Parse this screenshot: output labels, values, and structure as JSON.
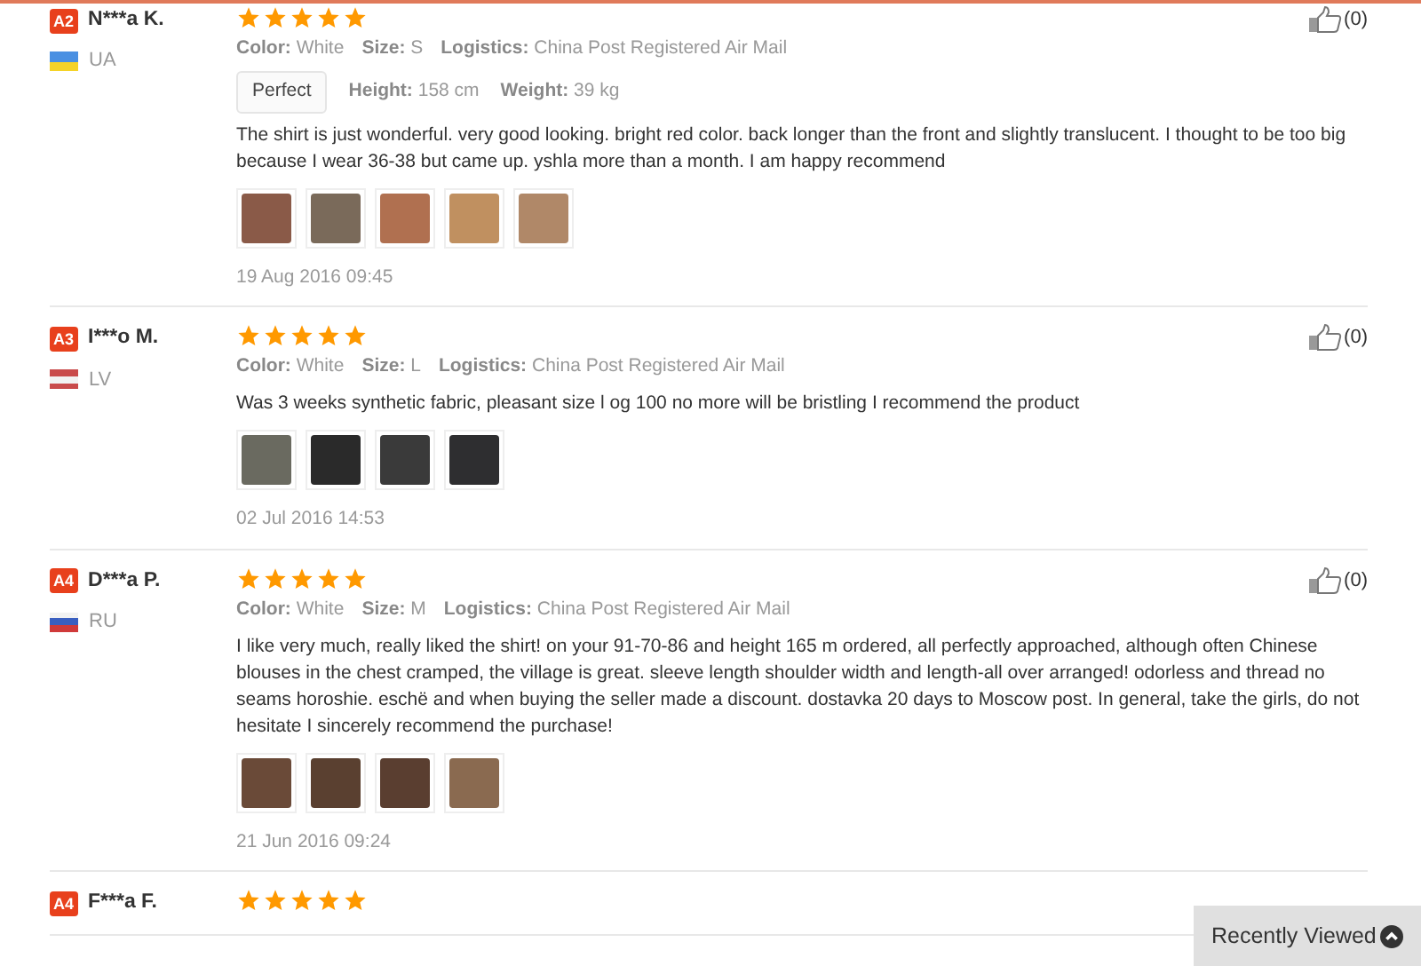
{
  "reviews": [
    {
      "badge": "A2",
      "name": "N***a K.",
      "country": "UA",
      "flag": [
        {
          "color": "#4a90e2"
        },
        {
          "color": "#f5d327"
        }
      ],
      "stars": 5,
      "attributes": [
        {
          "label": "Color:",
          "value": "White"
        },
        {
          "label": "Size:",
          "value": "S"
        },
        {
          "label": "Logistics:",
          "value": "China Post Registered Air Mail"
        }
      ],
      "fit_tag": "Perfect",
      "measurements": [
        {
          "label": "Height:",
          "value": "158 cm"
        },
        {
          "label": "Weight:",
          "value": "39 kg"
        }
      ],
      "text": "The shirt is just wonderful. very good looking. bright red color. back longer than the front and slightly translucent. I thought to be too big because I wear 36-38 but came up. yshla more than a month. I am happy recommend",
      "photos": [
        {
          "color": "#8a5a48"
        },
        {
          "color": "#7a6a5a"
        },
        {
          "color": "#b07050"
        },
        {
          "color": "#c09060"
        },
        {
          "color": "#b08868"
        }
      ],
      "date": "19 Aug 2016 09:45",
      "likes": "(0)"
    },
    {
      "badge": "A3",
      "name": "I***o M.",
      "country": "LV",
      "flag": [
        {
          "color": "#c94b4b"
        },
        {
          "color": "#f2f2f2"
        },
        {
          "color": "#c94b4b"
        }
      ],
      "stars": 5,
      "attributes": [
        {
          "label": "Color:",
          "value": "White"
        },
        {
          "label": "Size:",
          "value": "L"
        },
        {
          "label": "Logistics:",
          "value": "China Post Registered Air Mail"
        }
      ],
      "text": "Was 3 weeks synthetic fabric, pleasant size l og 100 no more will be bristling I recommend the product",
      "photos": [
        {
          "color": "#6a6a60"
        },
        {
          "color": "#2a2a2a"
        },
        {
          "color": "#3a3a3a"
        },
        {
          "color": "#2e2e30"
        }
      ],
      "date": "02 Jul 2016 14:53",
      "likes": "(0)"
    },
    {
      "badge": "A4",
      "name": "D***a P.",
      "country": "RU",
      "flag": [
        {
          "color": "#f2f2f2"
        },
        {
          "color": "#3a5fc0"
        },
        {
          "color": "#d03a3a"
        }
      ],
      "stars": 5,
      "attributes": [
        {
          "label": "Color:",
          "value": "White"
        },
        {
          "label": "Size:",
          "value": "M"
        },
        {
          "label": "Logistics:",
          "value": "China Post Registered Air Mail"
        }
      ],
      "text": "I like very much, really liked the shirt! on your 91-70-86 and height 165 m ordered, all perfectly approached, although often Chinese blouses in the chest cramped, the village is great. sleeve length shoulder width and length-all over arranged! odorless and thread no seams horoshie. eschë and when buying the seller made a discount. dostavka 20 days to Moscow post. In general, take the girls, do not hesitate I sincerely recommend the purchase!",
      "photos": [
        {
          "color": "#6a4a38"
        },
        {
          "color": "#5a4030"
        },
        {
          "color": "#5a3e30"
        },
        {
          "color": "#8a6a50"
        }
      ],
      "date": "21 Jun 2016 09:24",
      "likes": "(0)"
    },
    {
      "badge": "A4",
      "name": "F***a F.",
      "stars": 5
    }
  ],
  "recently_viewed": {
    "label": "Recently Viewed"
  }
}
